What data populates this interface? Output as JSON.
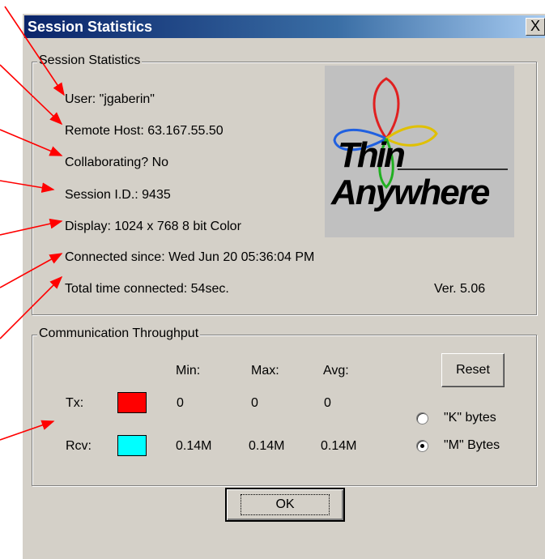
{
  "window": {
    "title": "Session Statistics",
    "close_label": "X"
  },
  "session": {
    "group_label": "Session Statistics",
    "user": "User:  \"jgaberin\"",
    "remote_host": "Remote Host:  63.167.55.50",
    "collaborating": "Collaborating? No",
    "session_id": "Session I.D.:  9435",
    "display": "Display:  1024 x 768  8 bit Color",
    "connected_since": "Connected since:  Wed Jun 20 05:36:04 PM",
    "total_time": "Total time connected:  54sec.",
    "version": "Ver. 5.06"
  },
  "logo": {
    "line1": "Thin",
    "line2": "Anywhere"
  },
  "throughput": {
    "group_label": "Communication Throughput",
    "headers": {
      "min": "Min:",
      "max": "Max:",
      "avg": "Avg:"
    },
    "rows": [
      {
        "label": "Tx:",
        "color": "#ff0000",
        "min": "0",
        "max": "0",
        "avg": "0"
      },
      {
        "label": "Rcv:",
        "color": "#00ffff",
        "min": "0.14M",
        "max": "0.14M",
        "avg": "0.14M"
      }
    ],
    "reset_label": "Reset",
    "units": [
      {
        "label": "\"K\" bytes",
        "selected": false
      },
      {
        "label": "\"M\" Bytes",
        "selected": true
      }
    ]
  },
  "ok_label": "OK",
  "colors": {
    "annotation_arrow": "#ff0000",
    "dialog_face": "#d4d0c8",
    "title_active": "#0a246a"
  }
}
